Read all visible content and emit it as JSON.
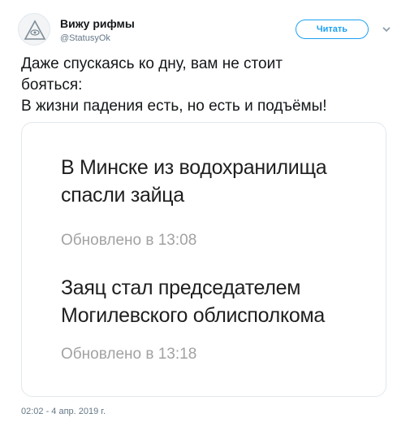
{
  "header": {
    "name": "Вижу рифмы",
    "handle": "@StatusyOk",
    "follow_label": "Читать",
    "avatar_icon": "eye-pyramid-icon",
    "more_icon": "chevron-down-icon"
  },
  "tweet": {
    "lines": [
      "Даже спускаясь ко дну, вам не стоит",
      "бояться:",
      "В жизни падения есть, но есть и подъёмы!"
    ]
  },
  "media": {
    "news": [
      {
        "title_lines": [
          "В Минске из водохранилища",
          "спасли зайца"
        ],
        "updated": "Обновлено в 13:08"
      },
      {
        "title_lines": [
          "Заяц стал председателем",
          "Могилевского облисполкома"
        ],
        "updated": "Обновлено в 13:18"
      }
    ]
  },
  "timestamp": "02:02 - 4 апр. 2019 г.",
  "colors": {
    "accent": "#1da1f2",
    "text": "#14171a",
    "muted": "#657786",
    "news_time": "#a2a2a2"
  }
}
